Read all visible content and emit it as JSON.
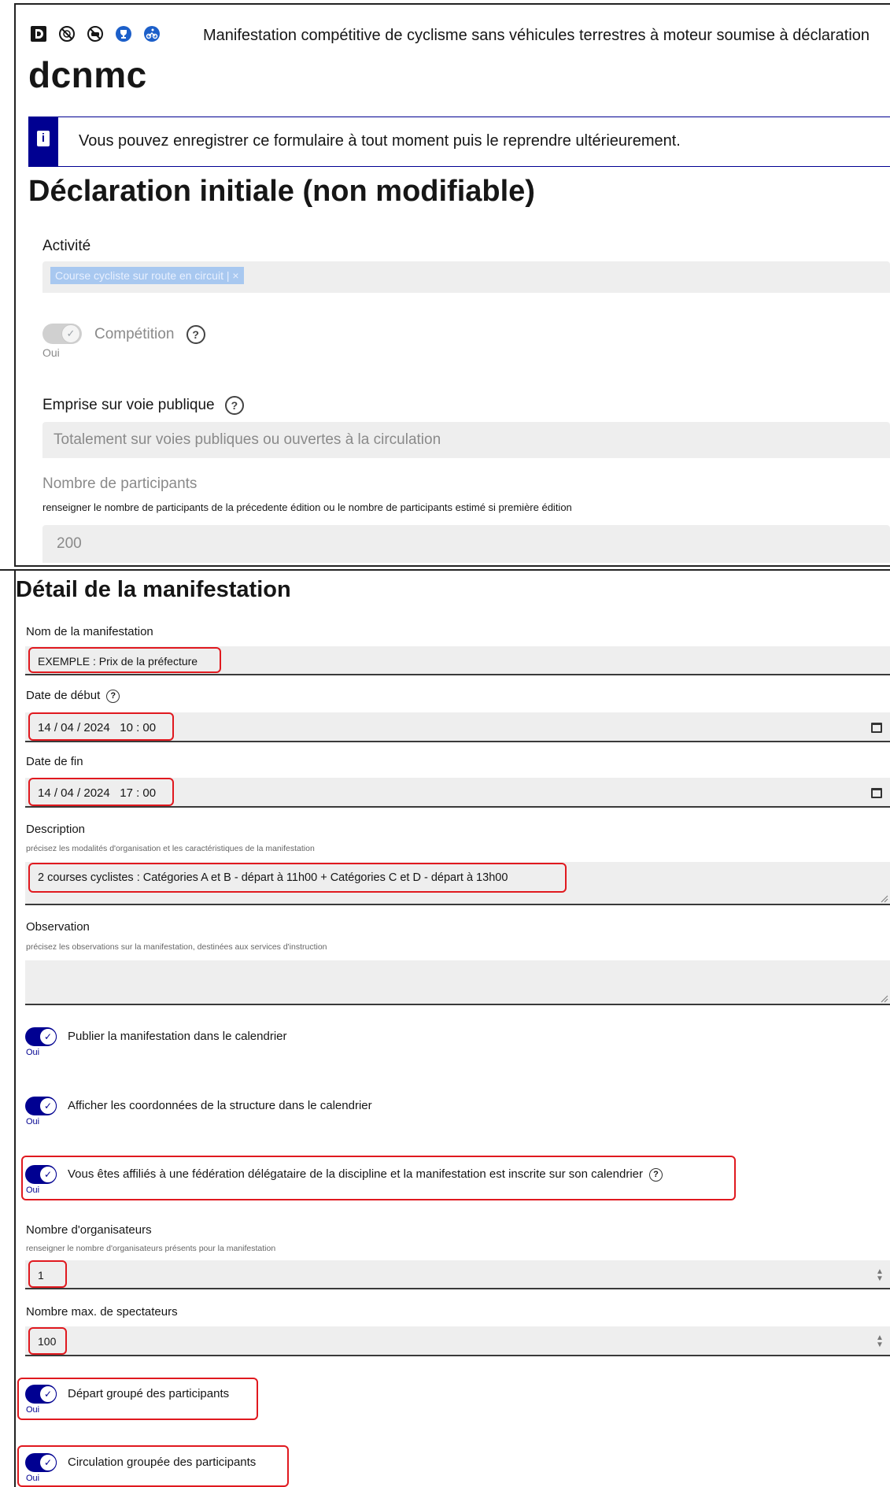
{
  "header": {
    "icons": [
      "document-d-icon",
      "no-entry-icon",
      "no-car-icon",
      "trophy-icon",
      "cyclist-icon"
    ],
    "title": "Manifestation compétitive de cyclisme sans véhicules terrestres à moteur soumise à déclaration",
    "code": "dcnmc"
  },
  "info_notice": {
    "icon": "info-icon",
    "text": "Vous pouvez enregistrer ce formulaire à tout moment puis le reprendre ultérieurement."
  },
  "initial_declaration": {
    "title": "Déclaration initiale (non modifiable)",
    "activity_label": "Activité",
    "activity_tag": "Course cycliste sur route en circuit | ×",
    "competition_label": "Compétition",
    "competition_state": "Oui",
    "emprise_label": "Emprise sur voie publique",
    "emprise_value": "Totalement sur voies publiques ou ouvertes à la circulation",
    "participants_label": "Nombre de participants",
    "participants_hint": "renseigner le nombre de participants de la précedente édition ou le nombre de participants estimé si première édition",
    "participants_value": "200"
  },
  "detail": {
    "title": "Détail de la manifestation",
    "name_label": "Nom de la manifestation",
    "name_value": "EXEMPLE : Prix de la préfecture",
    "start_label": "Date de début",
    "start_value": "14 / 04 / 2024   10 : 00",
    "end_label": "Date de fin",
    "end_value": "14 / 04 / 2024   17 : 00",
    "description_label": "Description",
    "description_hint": "précisez les modalités d'organisation et les caractéristiques de la manifestation",
    "description_value": "2 courses cyclistes : Catégories A et B - départ à 11h00 + Catégories C et D - départ à 13h00",
    "observation_label": "Observation",
    "observation_hint": "précisez les observations sur la manifestation, destinées aux services d'instruction",
    "observation_value": "",
    "toggles": [
      {
        "label": "Publier la manifestation dans le calendrier",
        "state": "Oui"
      },
      {
        "label": "Afficher les coordonnées de la structure dans le calendrier",
        "state": "Oui"
      },
      {
        "label": "Vous êtes affiliés à une fédération délégataire de la discipline et la manifestation est inscrite sur son calendrier",
        "state": "Oui"
      }
    ],
    "organisers_label": "Nombre d'organisateurs",
    "organisers_hint": "renseigner le nombre d'organisateurs présents pour la manifestation",
    "organisers_value": "1",
    "spectators_label": "Nombre max. de spectateurs",
    "spectators_value": "100",
    "grouped_start_label": "Départ groupé des participants",
    "grouped_start_state": "Oui",
    "grouped_circulation_label": "Circulation groupée des participants",
    "grouped_circulation_state": "Oui"
  },
  "colors": {
    "primary": "#000091",
    "highlight": "#e0191f",
    "field_bg": "#eeeeee"
  }
}
